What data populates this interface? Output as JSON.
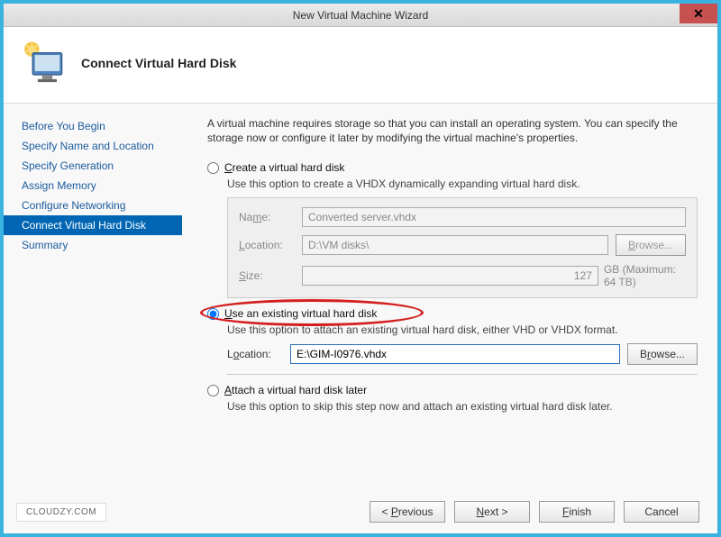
{
  "window": {
    "title": "New Virtual Machine Wizard",
    "close_glyph": "✕"
  },
  "header": {
    "title": "Connect Virtual Hard Disk"
  },
  "sidebar": {
    "items": [
      {
        "label": "Before You Begin"
      },
      {
        "label": "Specify Name and Location"
      },
      {
        "label": "Specify Generation"
      },
      {
        "label": "Assign Memory"
      },
      {
        "label": "Configure Networking"
      },
      {
        "label": "Connect Virtual Hard Disk"
      },
      {
        "label": "Summary"
      }
    ],
    "active_index": 5
  },
  "content": {
    "intro": "A virtual machine requires storage so that you can install an operating system. You can specify the storage now or configure it later by modifying the virtual machine's properties.",
    "options": {
      "create": {
        "label": "Create a virtual hard disk",
        "desc": "Use this option to create a VHDX dynamically expanding virtual hard disk.",
        "name_label": "Name:",
        "name_value": "Converted server.vhdx",
        "location_label": "Location:",
        "location_value": "D:\\VM disks\\",
        "browse_label": "Browse...",
        "size_label": "Size:",
        "size_value": "127",
        "size_suffix": "GB (Maximum: 64 TB)"
      },
      "existing": {
        "label": "Use an existing virtual hard disk",
        "desc": "Use this option to attach an existing virtual hard disk, either VHD or VHDX format.",
        "location_label": "Location:",
        "location_value": "E:\\GIM-I0976.vhdx",
        "browse_label": "Browse..."
      },
      "later": {
        "label": "Attach a virtual hard disk later",
        "desc": "Use this option to skip this step now and attach an existing virtual hard disk later."
      },
      "selected": "existing"
    }
  },
  "footer": {
    "watermark": "CLOUDZY.COM",
    "buttons": {
      "previous": "< Previous",
      "next": "Next >",
      "finish": "Finish",
      "cancel": "Cancel"
    }
  }
}
